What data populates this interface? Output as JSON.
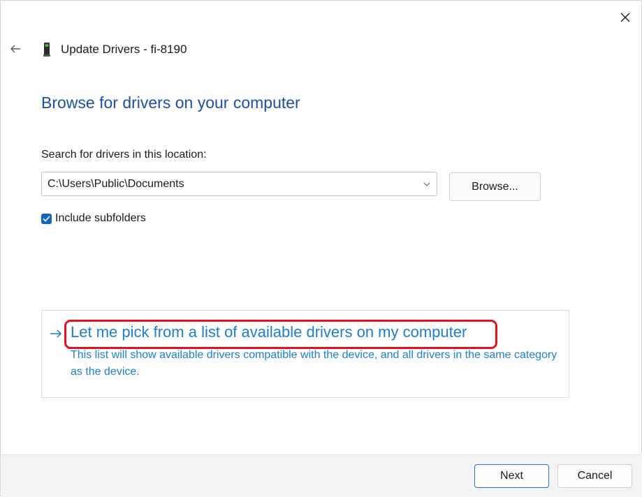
{
  "window": {
    "title": "Update Drivers - fi-8190",
    "icons": {
      "close": "close-icon",
      "back": "back-arrow-icon",
      "device": "scanner-device-icon"
    }
  },
  "main": {
    "heading": "Browse for drivers on your computer",
    "search_label": "Search for drivers in this location:",
    "path_value": "C:\\Users\\Public\\Documents",
    "browse_label": "Browse...",
    "include_subfolders": {
      "label": "Include subfolders",
      "checked": true
    }
  },
  "pick_option": {
    "link_text": "Let me pick from a list of available drivers on my computer",
    "description": "This list will show available drivers compatible with the device, and all drivers in the same category as the device."
  },
  "footer": {
    "next_label": "Next",
    "cancel_label": "Cancel"
  },
  "colors": {
    "accent": "#1565c0",
    "heading": "#1e4ea6",
    "link": "#1b7fd1",
    "highlight": "#e0121c"
  }
}
